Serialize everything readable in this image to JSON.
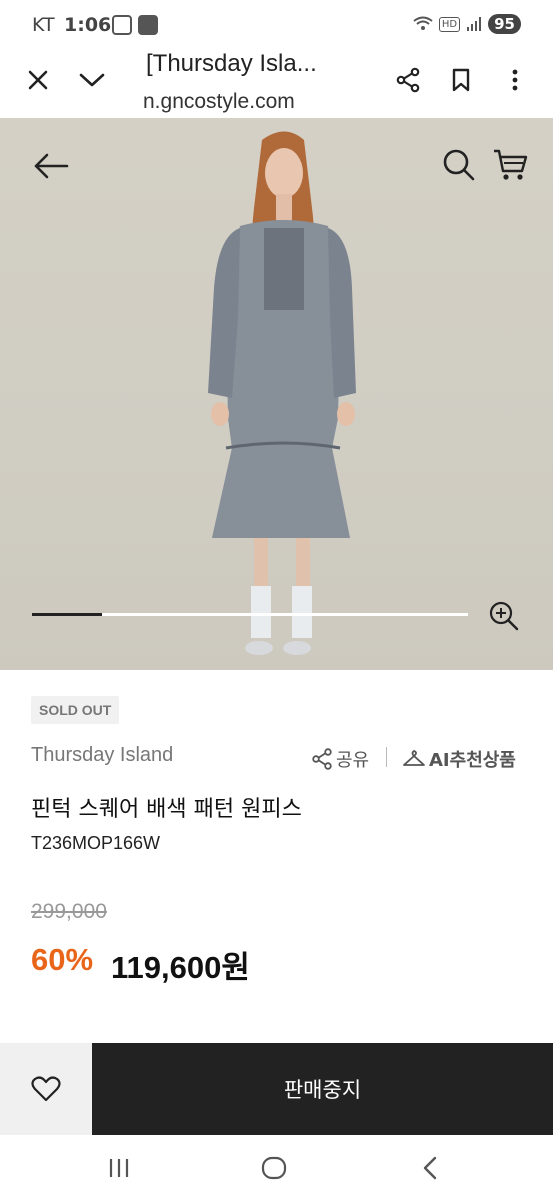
{
  "status_bar": {
    "carrier": "KT",
    "time": "1:06",
    "network": "HD",
    "battery": "95"
  },
  "browser": {
    "title": "[Thursday Isla...",
    "url": "n.gncostyle.com"
  },
  "product": {
    "badge": "SOLD OUT",
    "brand": "Thursday Island",
    "share_label": "공유",
    "ai_label": "AI추천상품",
    "name": "핀턱 스퀘어 배색 패턴 원피스",
    "code": "T236MOP166W",
    "original_price": "299,000",
    "discount": "60%",
    "price": "119,600원",
    "image_progress": 0.16
  },
  "bottom_bar": {
    "buy_label": "판매중지"
  },
  "colors": {
    "accent": "#e8651a",
    "dark": "#222222",
    "hero_bg": "#d2cec4"
  }
}
